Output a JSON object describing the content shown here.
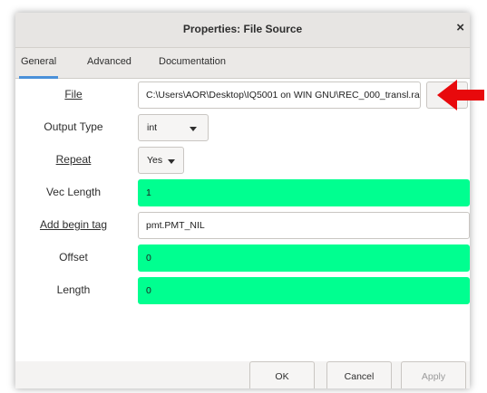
{
  "window": {
    "title": "Properties: File Source",
    "close_glyph": "×"
  },
  "tabs": [
    {
      "label": "General"
    },
    {
      "label": "Advanced"
    },
    {
      "label": "Documentation"
    }
  ],
  "fields": {
    "file": {
      "label": "File",
      "value": "C:\\Users\\AOR\\Desktop\\IQ5001 on WIN GNU\\REC_000_transl.ra"
    },
    "output_type": {
      "label": "Output Type",
      "value": "int"
    },
    "repeat": {
      "label": "Repeat",
      "value": "Yes"
    },
    "vec_length": {
      "label": "Vec Length",
      "value": "1"
    },
    "add_begin_tag": {
      "label": "Add begin tag",
      "value": "pmt.PMT_NIL"
    },
    "offset": {
      "label": "Offset",
      "value": "0"
    },
    "length": {
      "label": "Length",
      "value": "0"
    }
  },
  "buttons": {
    "ok": "OK",
    "cancel": "Cancel",
    "apply": "Apply"
  },
  "colors": {
    "valid_field": "#00ff90",
    "annotation_arrow": "#e8090c"
  }
}
